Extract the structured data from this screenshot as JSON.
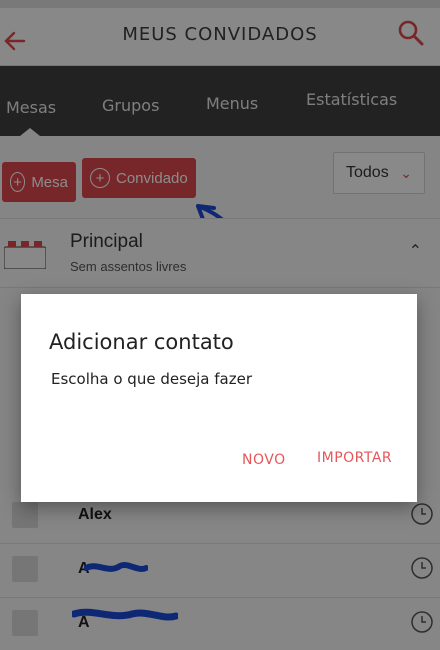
{
  "header": {
    "title": "MEUS CONVIDADOS",
    "back_icon": "arrow-left-icon",
    "search_icon": "search-icon"
  },
  "tabs": [
    {
      "label": "Mesas",
      "active": true
    },
    {
      "label": "Grupos",
      "active": false
    },
    {
      "label": "Menus",
      "active": false
    },
    {
      "label": "Estatísticas",
      "active": false
    }
  ],
  "actions": {
    "add_table_label": "Mesa",
    "add_guest_label": "Convidado",
    "filter_value": "Todos"
  },
  "table": {
    "name": "Principal",
    "subtitle": "Sem assentos livres"
  },
  "guests": [
    {
      "name": "Alex"
    },
    {
      "name": "A"
    },
    {
      "name": "A"
    }
  ],
  "dialog": {
    "title": "Adicionar contato",
    "message": "Escolha o que deseja fazer",
    "buttons": {
      "new": "NOVO",
      "import": "IMPORTAR"
    }
  },
  "colors": {
    "accent": "#d9474b",
    "tabbar": "#3f3f3f",
    "annotation": "#1a49d6"
  }
}
